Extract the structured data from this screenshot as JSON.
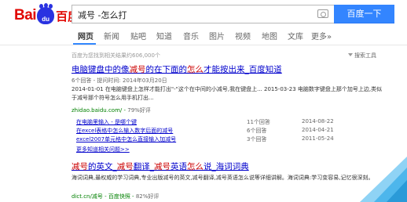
{
  "logo": {
    "text_left": "Bai",
    "text_paw": "du",
    "text_cn": "百度"
  },
  "search": {
    "query": "减号 -怎么打",
    "button_label": "百度一下"
  },
  "nav": {
    "items": [
      {
        "label": "网页"
      },
      {
        "label": "新闻"
      },
      {
        "label": "贴吧"
      },
      {
        "label": "知道"
      },
      {
        "label": "音乐"
      },
      {
        "label": "图片"
      },
      {
        "label": "视频"
      },
      {
        "label": "地图"
      },
      {
        "label": "文库"
      },
      {
        "label": "更多»"
      }
    ]
  },
  "result_count": "百度为您找到相关结果约606,000个",
  "search_tools": "搜索工具",
  "result1": {
    "title_parts": [
      "电脑键盘中的像",
      "减号",
      "的在下面的",
      "怎么",
      "才能按出来_百度知道"
    ],
    "meta": "6个回答 - 提问时间: 2014年03月20日",
    "snippet": "2014-01-01 在电脑键盘上怎样才能打出\"-\"这个在中间的小减号,我在键盘上... 2015-03-23 电脑数字键盘上那个加号上边,类似于减号那个符号怎么用手机打出...",
    "url": "zhidao.baidu.com/ - ",
    "rate": "79%好评",
    "subs": [
      {
        "q": "在电脑里输入 - 是哪个键",
        "a": "11个回答",
        "d": "2014-08-22"
      },
      {
        "q": "在excel表格中怎么输入数字后面的减号",
        "a": "6个回答",
        "d": "2014-04-21"
      },
      {
        "q": "excel2007单元格中怎么直接输入加减号",
        "a": "3个回答",
        "d": "2011-05-24"
      }
    ],
    "more": "更多知道相关问题>>"
  },
  "result2": {
    "title_parts": [
      "减号",
      "的英文_",
      "减号",
      "翻译_",
      "减号",
      "英语",
      "怎么",
      "说_海词词典"
    ],
    "snippet": "海词词典,最权威的学习词典,专业出版减号的英文,减号翻译,减号英语怎么说等详细讲解。海词词典:学习变容易,记忆很深刻。",
    "url": "dict.cn/减号 - 百度快照 - ",
    "rate": "82%好评"
  },
  "colors": {
    "accent": "#3385ff",
    "link": "#0000cc",
    "highlight": "#cc0000",
    "url": "#008000"
  },
  "icons": [
    "camera-icon",
    "filter-icon"
  ]
}
